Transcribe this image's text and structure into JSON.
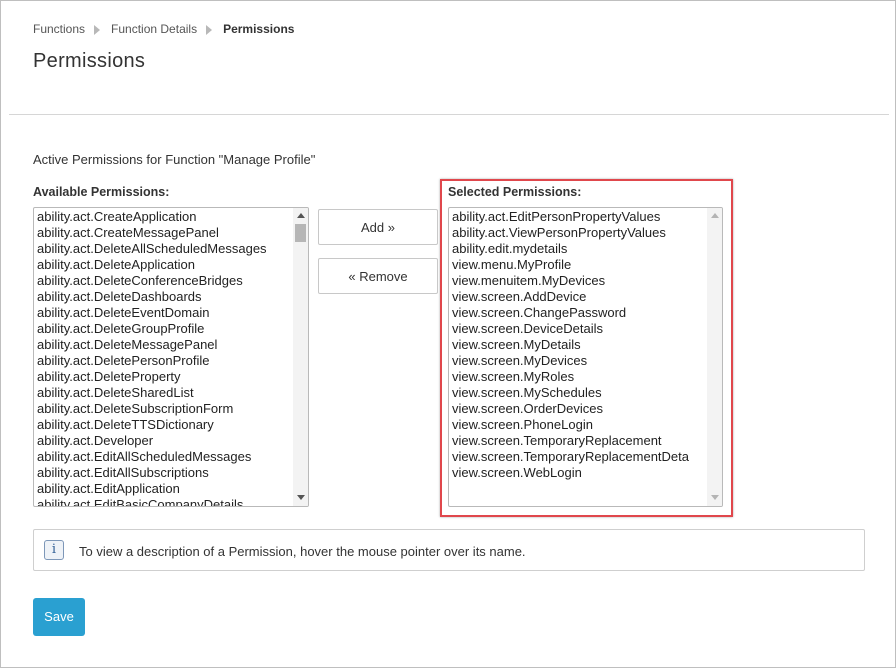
{
  "breadcrumb": {
    "items": [
      "Functions",
      "Function Details",
      "Permissions"
    ]
  },
  "page": {
    "title": "Permissions",
    "subtitle": "Active Permissions for Function \"Manage Profile\""
  },
  "available": {
    "label": "Available Permissions:",
    "items": [
      "ability.act.CreateApplication",
      "ability.act.CreateMessagePanel",
      "ability.act.DeleteAllScheduledMessages",
      "ability.act.DeleteApplication",
      "ability.act.DeleteConferenceBridges",
      "ability.act.DeleteDashboards",
      "ability.act.DeleteEventDomain",
      "ability.act.DeleteGroupProfile",
      "ability.act.DeleteMessagePanel",
      "ability.act.DeletePersonProfile",
      "ability.act.DeleteProperty",
      "ability.act.DeleteSharedList",
      "ability.act.DeleteSubscriptionForm",
      "ability.act.DeleteTTSDictionary",
      "ability.act.Developer",
      "ability.act.EditAllScheduledMessages",
      "ability.act.EditAllSubscriptions",
      "ability.act.EditApplication",
      "ability.act.EditBasicCompanyDetails"
    ]
  },
  "selected": {
    "label": "Selected Permissions:",
    "items": [
      "ability.act.EditPersonPropertyValues",
      "ability.act.ViewPersonPropertyValues",
      "ability.edit.mydetails",
      "view.menu.MyProfile",
      "view.menuitem.MyDevices",
      "view.screen.AddDevice",
      "view.screen.ChangePassword",
      "view.screen.DeviceDetails",
      "view.screen.MyDetails",
      "view.screen.MyDevices",
      "view.screen.MyRoles",
      "view.screen.MySchedules",
      "view.screen.OrderDevices",
      "view.screen.PhoneLogin",
      "view.screen.TemporaryReplacement",
      "view.screen.TemporaryReplacementDeta",
      "view.screen.WebLogin"
    ]
  },
  "actions": {
    "add_label": "Add »",
    "remove_label": "« Remove",
    "save_label": "Save"
  },
  "info": {
    "icon_glyph": "i",
    "text": "To view a description of a Permission, hover the mouse pointer over its name."
  },
  "colors": {
    "accent": "#2aa0d1",
    "highlight": "#e0474c"
  }
}
